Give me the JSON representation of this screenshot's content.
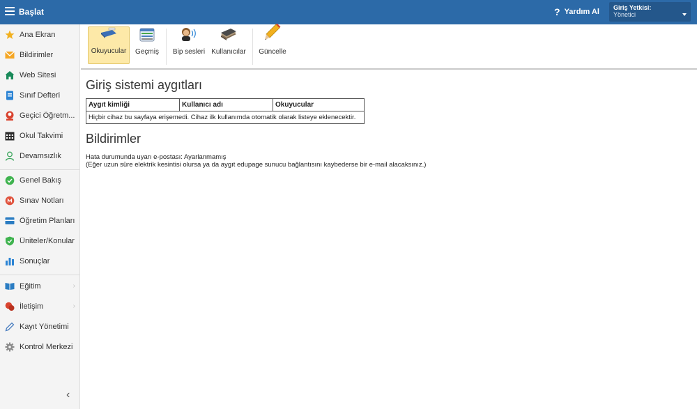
{
  "header": {
    "title": "Başlat",
    "help_label": "Yardım Al",
    "role_label": "Giriş Yetkisi:",
    "role_value": "Yönetici"
  },
  "sidebar": {
    "items": [
      {
        "label": "Ana Ekran",
        "icon": "star-icon",
        "color": "#f2b01e"
      },
      {
        "label": "Bildirimler",
        "icon": "envelope-icon",
        "color": "#f5a623"
      },
      {
        "label": "Web Sitesi",
        "icon": "home-icon",
        "color": "#1a8a5a"
      },
      {
        "label": "Sınıf Defteri",
        "icon": "notebook-icon",
        "color": "#2a83d4"
      },
      {
        "label": "Geçici Öğretm...",
        "icon": "teacher-icon",
        "color": "#d9432f"
      },
      {
        "label": "Okul Takvimi",
        "icon": "calendar-icon",
        "color": "#2b2b2b"
      },
      {
        "label": "Devamsızlık",
        "icon": "person-icon",
        "color": "#3aa55b"
      },
      {
        "label": "Genel Bakış",
        "icon": "check-circle-icon",
        "color": "#3fb34f"
      },
      {
        "label": "Sınav Notları",
        "icon": "grades-icon",
        "color": "#e0523c"
      },
      {
        "label": "Öğretim Planları",
        "icon": "folder-icon",
        "color": "#2a7cc2"
      },
      {
        "label": "Üniteler/Konular",
        "icon": "shield-check-icon",
        "color": "#3fb34f"
      },
      {
        "label": "Sonuçlar",
        "icon": "bar-chart-icon",
        "color": "#2a83d4"
      },
      {
        "label": "Eğitim",
        "icon": "book-icon",
        "color": "#2a7cc2"
      },
      {
        "label": "İletişim",
        "icon": "chat-icon",
        "color": "#d9432f"
      },
      {
        "label": "Kayıt Yönetimi",
        "icon": "pen-icon",
        "color": "#4a7fc1"
      },
      {
        "label": "Kontrol Merkezi",
        "icon": "gear-icon",
        "color": "#8a8a8a"
      }
    ]
  },
  "toolbar": {
    "buttons": [
      {
        "label": "Okuyucular",
        "icon": "card-reader-icon",
        "active": true
      },
      {
        "label": "Geçmiş",
        "icon": "history-list-icon",
        "active": false
      },
      {
        "label": "Bip sesleri",
        "icon": "speaker-person-icon",
        "active": false
      },
      {
        "label": "Kullanıcılar",
        "icon": "card-stack-icon",
        "active": false
      },
      {
        "label": "Güncelle",
        "icon": "pencil-icon",
        "active": false
      }
    ]
  },
  "main": {
    "devices_title": "Giriş sistemi aygıtları",
    "table": {
      "headers": [
        "Aygıt kimliği",
        "Kullanıcı adı",
        "Okuyucular"
      ],
      "empty_message": "Hiçbir cihaz bu sayfaya erişemedi. Cihaz ilk kullanımda otomatik olarak listeye eklenecektir."
    },
    "notifications_title": "Bildirimler",
    "alert_line": "Hata durumunda uyarı e-postası: Ayarlanmamış",
    "alert_note": "(Eğer uzun süre elektrik kesintisi olursa ya da aygıt edupage sunucu bağlantısını kaybederse bir e-mail alacaksınız.)"
  }
}
